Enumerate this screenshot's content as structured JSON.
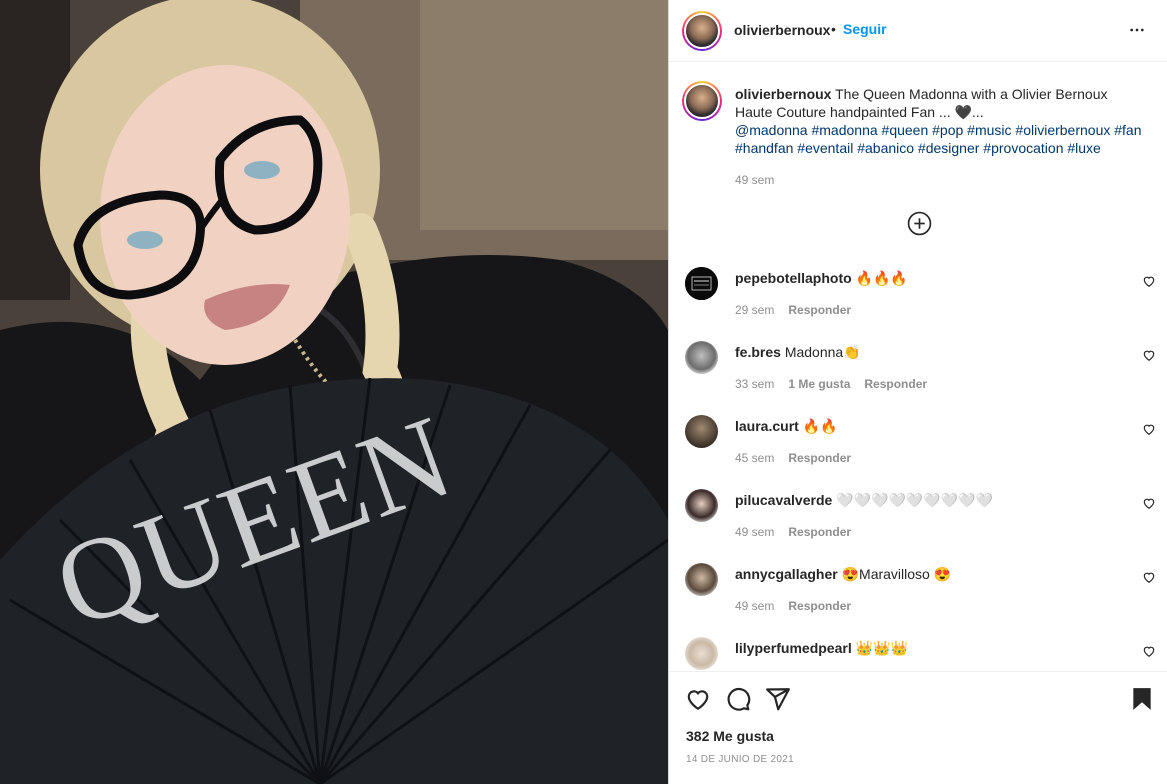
{
  "post": {
    "image_alt": "Woman with glasses and braids holding a black fan with QUEEN",
    "fan_text": "QUEEN"
  },
  "header": {
    "username": "olivierbernoux",
    "separator": "•",
    "follow_label": "Seguir",
    "more_icon": "more-horizontal-icon"
  },
  "caption": {
    "username": "olivierbernoux",
    "text": " The Queen Madonna with a Olivier Bernoux Haute Couture handpainted Fan ... 🖤...",
    "tags": "@madonna #madonna #queen #pop #music #olivierbernoux #fan #handfan #eventail #abanico #designer #provocation #luxe",
    "time": "49 sem"
  },
  "comments": [
    {
      "username": "pepebotellaphoto",
      "text": "🔥🔥🔥",
      "time": "29 sem",
      "likes": "",
      "reply": "Responder"
    },
    {
      "username": "fe.bres",
      "text": "Madonna👏",
      "time": "33 sem",
      "likes": "1 Me gusta",
      "reply": "Responder"
    },
    {
      "username": "laura.curt",
      "text": "🔥🔥",
      "time": "45 sem",
      "likes": "",
      "reply": "Responder"
    },
    {
      "username": "pilucavalverde",
      "text": "🤍🤍🤍🤍🤍🤍🤍🤍🤍",
      "time": "49 sem",
      "likes": "",
      "reply": "Responder"
    },
    {
      "username": "annycgallagher",
      "text": "😍Maravilloso 😍",
      "time": "49 sem",
      "likes": "",
      "reply": "Responder"
    },
    {
      "username": "lilyperfumedpearl",
      "text": "👑👑👑",
      "time": "",
      "likes": "",
      "reply": ""
    }
  ],
  "actions": {
    "likes_text": "382 Me gusta",
    "date": "14 DE JUNIO DE 2021"
  },
  "colors": {
    "link_blue": "#0095f6",
    "hashtag_blue": "#00376b",
    "muted": "#8e8e8e",
    "text": "#262626"
  }
}
